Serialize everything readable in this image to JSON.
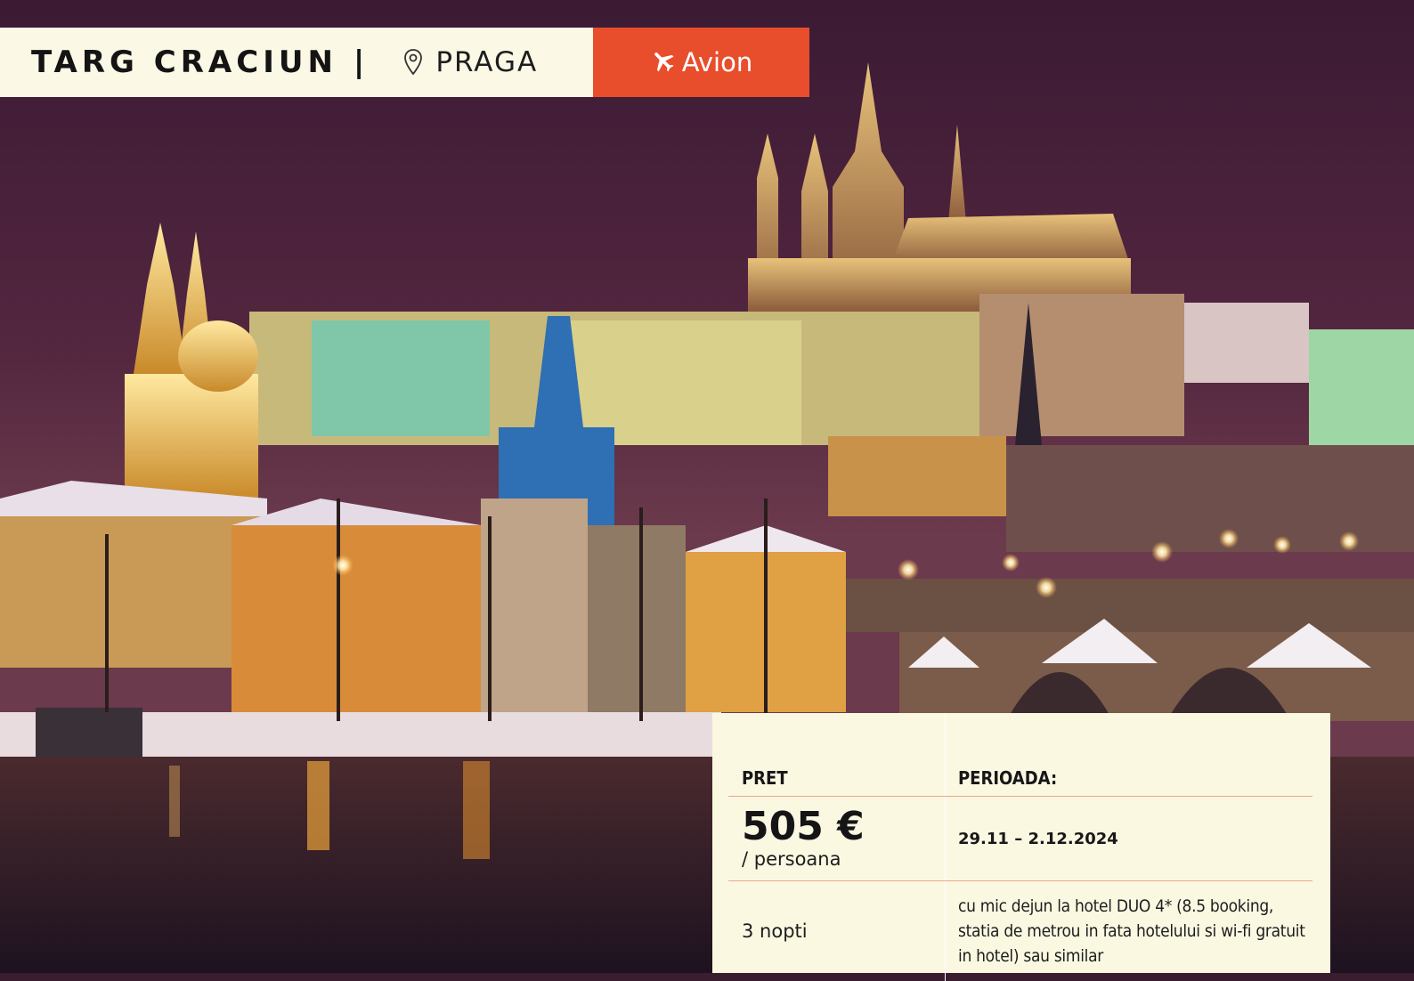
{
  "header": {
    "title": "TARG CRACIUN",
    "separator": "|",
    "location_icon": "map-pin-icon",
    "city": "PRAGA",
    "transport": {
      "icon": "airplane-icon",
      "label": "Avion",
      "color": "#e84e2c"
    }
  },
  "hero": {
    "image": "prague-castle-night-panorama"
  },
  "price_card": {
    "col_price_header": "PRET",
    "col_period_header": "PERIOADA:",
    "price": "505 €",
    "price_unit": "/ persoana",
    "period": "29.11 – 2.12.2024",
    "nights": "3 nopti",
    "hotel_details": "cu mic dejun la hotel DUO 4* (8.5 booking, statia de metrou in fata hotelului si wi-fi gratuit in hotel) sau similar"
  },
  "colors": {
    "title_bg": "#fbf8e6",
    "card_bg": "#fbf8e2",
    "accent": "#e84e2c",
    "divider": "#f0a68a"
  }
}
